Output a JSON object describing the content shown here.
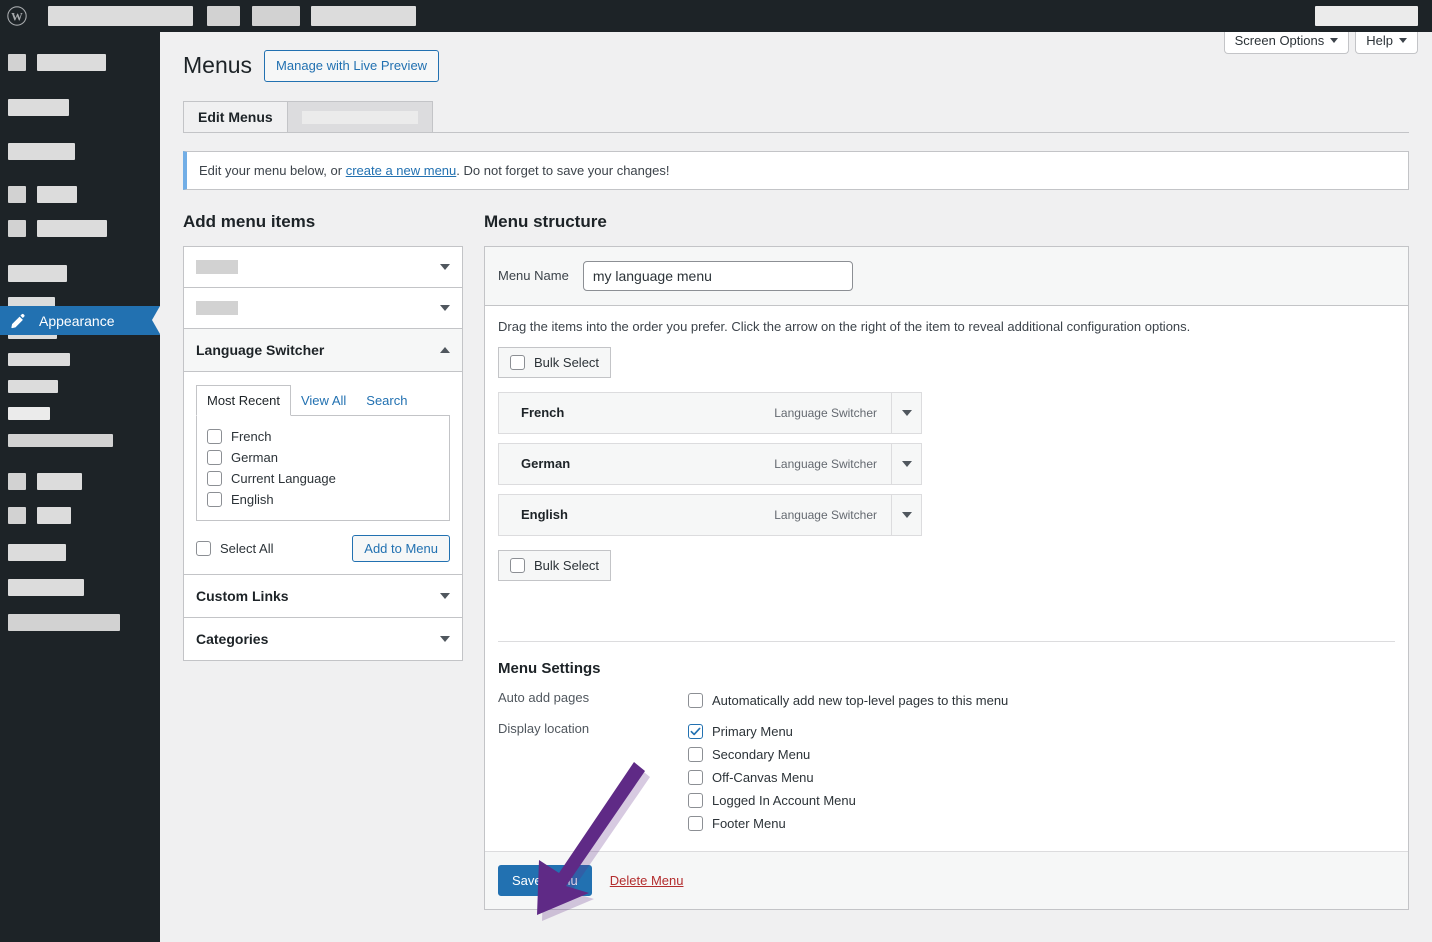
{
  "admin_bar": {
    "logo_icon": "wordpress-logo-icon"
  },
  "sidebar": {
    "active_item": {
      "label": "Appearance",
      "icon": "paintbrush-icon",
      "highlight_color": "#2271b1"
    }
  },
  "screen_meta": {
    "screen_options_label": "Screen Options",
    "help_label": "Help"
  },
  "header": {
    "title": "Menus",
    "live_preview_button": "Manage with Live Preview"
  },
  "tabs": [
    {
      "label": "Edit Menus",
      "active": true
    },
    {
      "label": "",
      "active": false,
      "redacted": true
    }
  ],
  "notice": {
    "before_link": "Edit your menu below, or ",
    "link": "create a new menu",
    "after_link": ". Do not forget to save your changes!"
  },
  "add_menu_items": {
    "title": "Add menu items",
    "panels": [
      {
        "label": "",
        "redacted": true,
        "open": false,
        "icon": "chevron-down-icon"
      },
      {
        "label": "",
        "redacted": true,
        "open": false,
        "icon": "chevron-down-icon"
      },
      {
        "label": "Language Switcher",
        "redacted": false,
        "open": true,
        "icon": "chevron-up-icon"
      },
      {
        "label": "Custom Links",
        "redacted": false,
        "open": false,
        "icon": "chevron-down-icon"
      },
      {
        "label": "Categories",
        "redacted": false,
        "open": false,
        "icon": "chevron-down-icon"
      }
    ],
    "language_switcher": {
      "tabs": [
        {
          "label": "Most Recent",
          "active": true
        },
        {
          "label": "View All",
          "active": false
        },
        {
          "label": "Search",
          "active": false
        }
      ],
      "options": [
        {
          "label": "French",
          "checked": false
        },
        {
          "label": "German",
          "checked": false
        },
        {
          "label": "Current Language",
          "checked": false
        },
        {
          "label": "English",
          "checked": false
        }
      ],
      "select_all_label": "Select All",
      "select_all_checked": false,
      "add_button": "Add to Menu"
    }
  },
  "menu_structure": {
    "title": "Menu structure",
    "name_label": "Menu Name",
    "name_value": "my language menu",
    "name_placeholder": "Menu Name",
    "hint": "Drag the items into the order you prefer. Click the arrow on the right of the item to reveal additional configuration options.",
    "bulk_select_top": "Bulk Select",
    "bulk_select_bottom": "Bulk Select",
    "items": [
      {
        "name": "French",
        "type": "Language Switcher"
      },
      {
        "name": "German",
        "type": "Language Switcher"
      },
      {
        "name": "English",
        "type": "Language Switcher"
      }
    ]
  },
  "menu_settings": {
    "title": "Menu Settings",
    "auto_add_label": "Auto add pages",
    "auto_add_option": {
      "label": "Automatically add new top-level pages to this menu",
      "checked": false
    },
    "display_location_label": "Display location",
    "locations": [
      {
        "label": "Primary Menu",
        "checked": true
      },
      {
        "label": "Secondary Menu",
        "checked": false
      },
      {
        "label": "Off-Canvas Menu",
        "checked": false
      },
      {
        "label": "Logged In Account Menu",
        "checked": false
      },
      {
        "label": "Footer Menu",
        "checked": false
      }
    ]
  },
  "footer_actions": {
    "save_label": "Save Menu",
    "delete_label": "Delete Menu"
  },
  "annotation": {
    "type": "arrow",
    "color": "#5f2a86",
    "points_to": "save-menu-button"
  }
}
